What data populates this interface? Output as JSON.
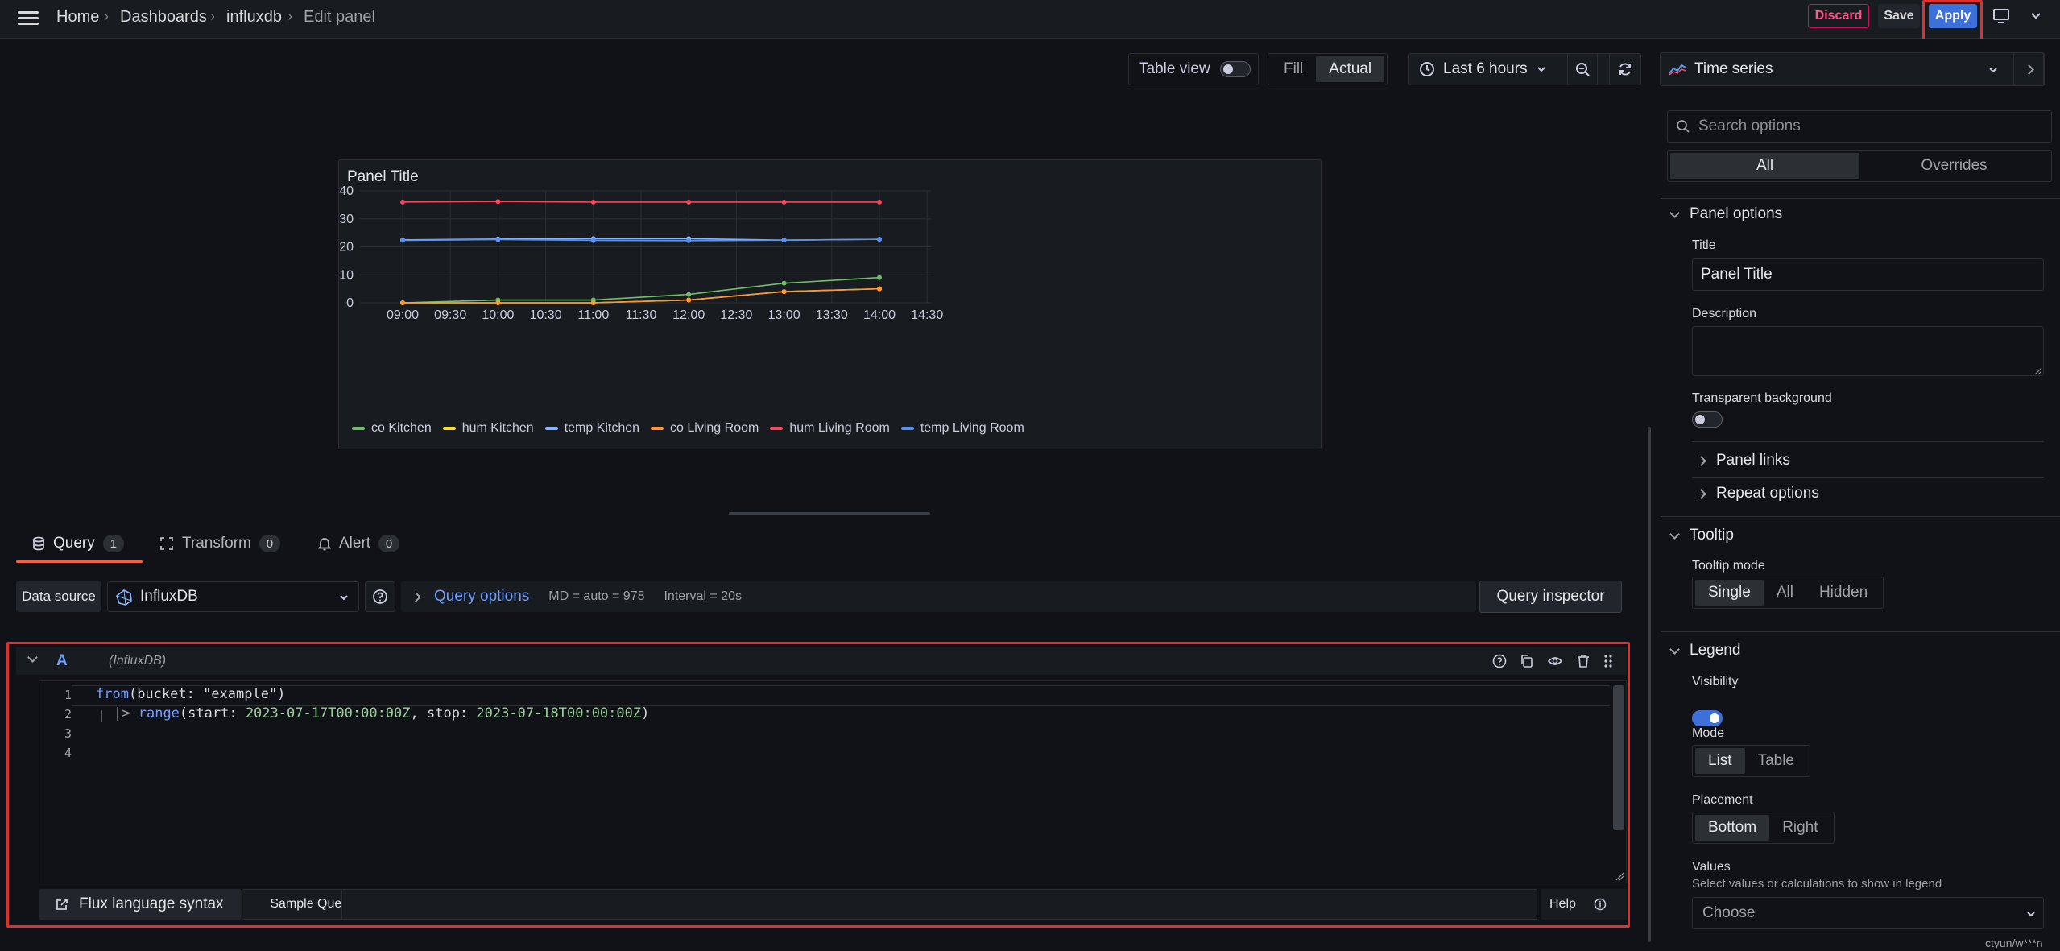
{
  "breadcrumb": {
    "home": "Home",
    "dashboards": "Dashboards",
    "dashboard": "influxdb",
    "current": "Edit panel"
  },
  "actions": {
    "discard": "Discard",
    "save": "Save",
    "apply": "Apply"
  },
  "toolbar": {
    "table_view": "Table view",
    "fill": "Fill",
    "actual": "Actual",
    "time_range": "Last 6 hours",
    "viz_type": "Time series"
  },
  "panel": {
    "title": "Panel Title"
  },
  "chart_data": {
    "type": "line",
    "x": [
      "09:00",
      "10:00",
      "11:00",
      "12:00",
      "13:00",
      "14:00"
    ],
    "x_ticks": [
      "09:00",
      "09:30",
      "10:00",
      "10:30",
      "11:00",
      "11:30",
      "12:00",
      "12:30",
      "13:00",
      "13:30",
      "14:00",
      "14:30"
    ],
    "y_ticks": [
      0,
      10,
      20,
      30,
      40
    ],
    "ylim": [
      0,
      40
    ],
    "legend_position": "bottom",
    "grid": true,
    "series": [
      {
        "name": "co Kitchen",
        "color": "#73bf69",
        "values": [
          0,
          1,
          1,
          3,
          7,
          9
        ]
      },
      {
        "name": "hum Kitchen",
        "color": "#fade2a",
        "values": [
          0,
          0,
          0,
          1,
          4,
          5
        ]
      },
      {
        "name": "temp Kitchen",
        "color": "#8ab8ff",
        "values": [
          22.5,
          22.8,
          22.9,
          22.9,
          22.4,
          22.7
        ]
      },
      {
        "name": "co Living Room",
        "color": "#ff9830",
        "values": [
          0,
          0,
          0,
          1,
          4,
          5
        ]
      },
      {
        "name": "hum Living Room",
        "color": "#f2495c",
        "values": [
          36,
          36.2,
          36,
          36,
          36,
          36
        ]
      },
      {
        "name": "temp Living Room",
        "color": "#5794f2",
        "values": [
          22.3,
          22.6,
          22.3,
          22.2,
          22.4,
          22.7
        ]
      }
    ]
  },
  "query_tabs": [
    {
      "label": "Query",
      "count": "1"
    },
    {
      "label": "Transform",
      "count": "0"
    },
    {
      "label": "Alert",
      "count": "0"
    }
  ],
  "datasource": {
    "label": "Data source",
    "value": "InfluxDB",
    "query_options": "Query options",
    "md": "MD = auto = 978",
    "interval": "Interval = 20s",
    "inspector": "Query inspector"
  },
  "query": {
    "ref": "A",
    "ds_name": "(InfluxDB)",
    "line_numbers": [
      "1",
      "2",
      "3",
      "4"
    ],
    "line1_kw": "from",
    "line1_rest": "(bucket: \"example\")",
    "line2_pipe": "|>",
    "line2_fn": "range",
    "line2_a": "(start: ",
    "line2_start": "2023-07-17T00:00:00Z",
    "line2_b": ", stop: ",
    "line2_stop": "2023-07-18T00:00:00Z",
    "line2_c": ")",
    "flux_syntax": "Flux language syntax",
    "sample_query": "Sample Query",
    "help": "Help"
  },
  "options": {
    "search_placeholder": "Search options",
    "tab_all": "All",
    "tab_overrides": "Overrides",
    "panel_options": "Panel options",
    "title_label": "Title",
    "title_value": "Panel Title",
    "description_label": "Description",
    "transparent_label": "Transparent background",
    "panel_links": "Panel links",
    "repeat_options": "Repeat options",
    "tooltip": "Tooltip",
    "tooltip_mode_label": "Tooltip mode",
    "tooltip_modes": [
      "Single",
      "All",
      "Hidden"
    ],
    "legend": "Legend",
    "visibility_label": "Visibility",
    "mode_label": "Mode",
    "modes": [
      "List",
      "Table"
    ],
    "placement_label": "Placement",
    "placements": [
      "Bottom",
      "Right"
    ],
    "values_label": "Values",
    "values_desc": "Select values or calculations to show in legend",
    "values_placeholder": "Choose"
  },
  "footer_user": "ctyun/w***n"
}
